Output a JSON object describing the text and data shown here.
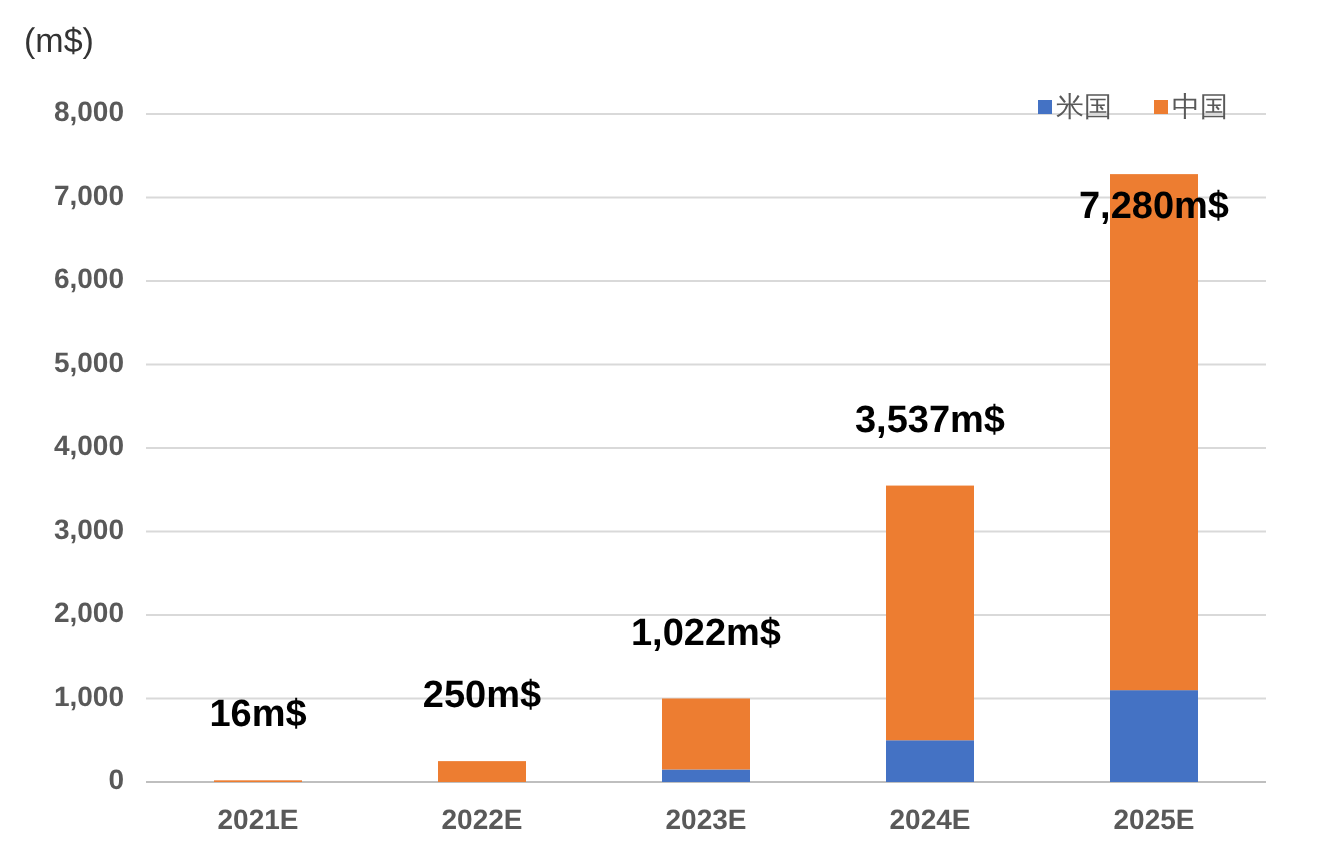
{
  "chart_data": {
    "type": "bar",
    "stacked": true,
    "grid": true,
    "legend": true,
    "ylabel": "(m$)",
    "categories": [
      "2021E",
      "2022E",
      "2023E",
      "2024E",
      "2025E"
    ],
    "series": [
      {
        "name": "米国",
        "color": "#4472c4",
        "values": [
          0,
          0,
          150,
          500,
          1100
        ]
      },
      {
        "name": "中国",
        "color": "#ed7d31",
        "values": [
          20,
          250,
          850,
          3050,
          6180
        ]
      }
    ],
    "ylim": [
      0,
      8000
    ],
    "yticks": [
      {
        "value": 0,
        "label": "0"
      },
      {
        "value": 1000,
        "label": "1,000"
      },
      {
        "value": 2000,
        "label": "2,000"
      },
      {
        "value": 3000,
        "label": "3,000"
      },
      {
        "value": 4000,
        "label": "4,000"
      },
      {
        "value": 5000,
        "label": "5,000"
      },
      {
        "value": 6000,
        "label": "6,000"
      },
      {
        "value": 7000,
        "label": "7,000"
      },
      {
        "value": 8000,
        "label": "8,000"
      }
    ],
    "annotations": [
      "16m$",
      "250m$",
      "1,022m$",
      "3,537m$",
      "7,280m$"
    ]
  }
}
